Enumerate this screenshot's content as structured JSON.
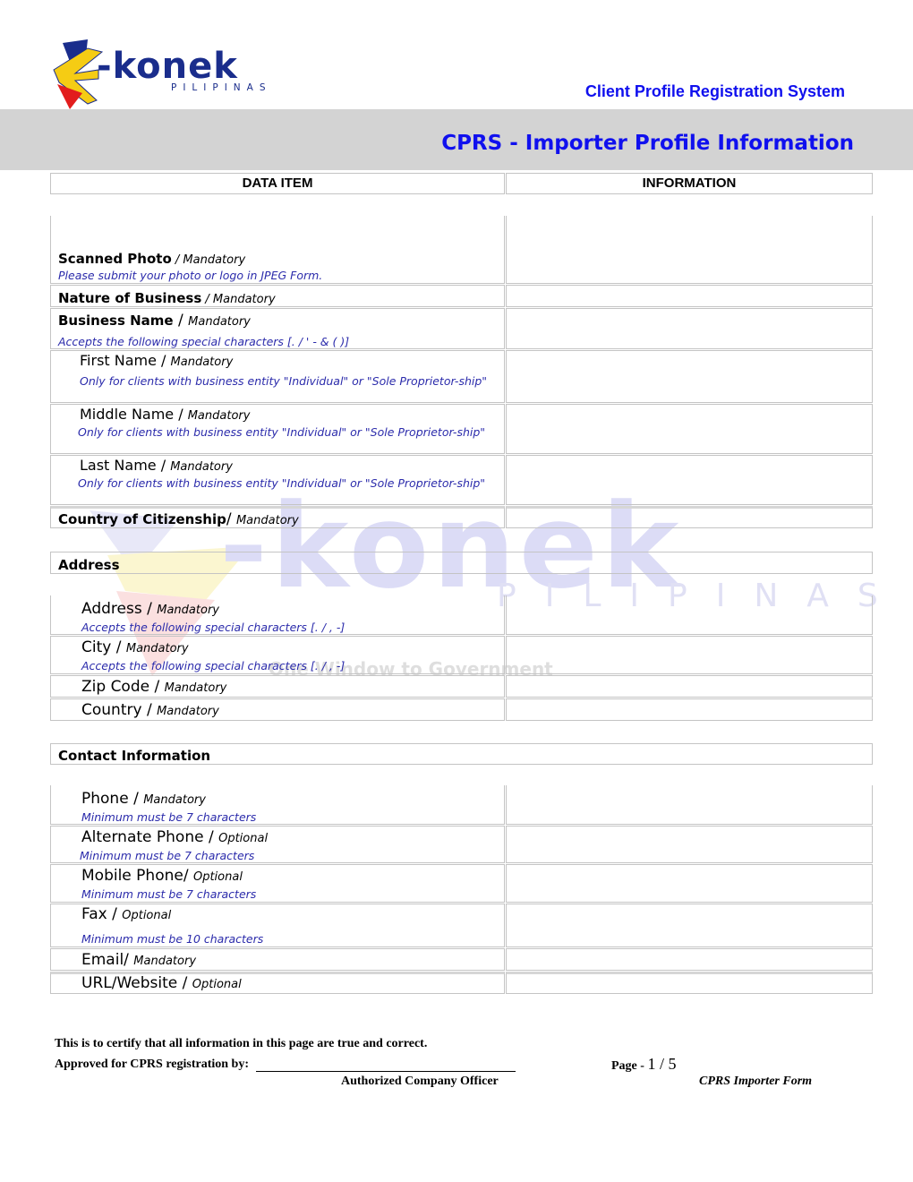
{
  "header": {
    "logo_text": "-konek",
    "logo_subtext": "PILIPINAS",
    "system_title": "Client Profile Registration System",
    "page_title": "CPRS - Importer Profile Information"
  },
  "watermark": {
    "word": "-konek",
    "sub": "PILIPINAS",
    "tagline": "One Window to Government"
  },
  "table": {
    "columns": [
      "DATA ITEM",
      "INFORMATION"
    ],
    "profile_rows": [
      {
        "label": "Scanned Photo",
        "requirement": " / Mandatory",
        "hint": "Please submit your photo or logo in JPEG Form.",
        "value": ""
      },
      {
        "label": "Nature of Business",
        "requirement": " / Mandatory",
        "hint": "",
        "value": ""
      },
      {
        "label": "Business Name",
        "separator": " / ",
        "requirement": "Mandatory",
        "hint": "Accepts the following special characters [. / ' - & ( )]",
        "value": ""
      },
      {
        "label": "First Name / ",
        "requirement": "Mandatory",
        "hint": "Only for clients with business entity \"Individual\" or \"Sole Proprietor-ship\"",
        "value": ""
      },
      {
        "label": "Middle Name / ",
        "requirement": "Mandatory",
        "hint": "Only for clients with business entity \"Individual\" or \"Sole Proprietor-ship\"",
        "value": ""
      },
      {
        "label": "Last Name / ",
        "requirement": "Mandatory",
        "hint": "Only for clients with business entity \"Individual\" or \"Sole Proprietor-ship\"",
        "value": ""
      },
      {
        "label": "Country of Citizenship",
        "separator": "/ ",
        "requirement": "Mandatory",
        "hint": "",
        "value": ""
      }
    ],
    "address_section": "Address",
    "address_rows": [
      {
        "label": "Address / ",
        "requirement": "Mandatory",
        "hint": "Accepts the following special characters [. / , -]",
        "value": ""
      },
      {
        "label": "City / ",
        "requirement": "Mandatory",
        "hint": "Accepts the following special characters [. / , -]",
        "value": ""
      },
      {
        "label": "Zip Code / ",
        "requirement": "Mandatory",
        "hint": "",
        "value": ""
      },
      {
        "label": "Country / ",
        "requirement": "Mandatory",
        "hint": "",
        "value": ""
      }
    ],
    "contact_section": "Contact Information",
    "contact_rows": [
      {
        "label": "Phone / ",
        "requirement": "Mandatory",
        "hint": "Minimum must be 7 characters",
        "value": ""
      },
      {
        "label": "Alternate Phone / ",
        "requirement": "Optional",
        "hint": "Minimum must be 7 characters",
        "value": ""
      },
      {
        "label": "Mobile Phone/ ",
        "requirement": "Optional",
        "hint": "Minimum must be 7 characters",
        "value": ""
      },
      {
        "label": "Fax / ",
        "requirement": "Optional",
        "hint": "Minimum must be 10 characters",
        "value": ""
      },
      {
        "label": "Email/ ",
        "requirement": "Mandatory",
        "hint": "",
        "value": ""
      },
      {
        "label": "URL/Website / ",
        "requirement": "Optional",
        "hint": "",
        "value": ""
      }
    ]
  },
  "footer": {
    "certify_text": "This is to certify that all information in this page are true and correct.",
    "approved_label": "Approved for CPRS registration by:",
    "signature_caption": "Authorized Company Officer",
    "page_label": "Page - ",
    "page_value": "1 / 5",
    "form_name": "CPRS Importer Form"
  },
  "colors": {
    "title_blue": "#1010ee",
    "hint_blue": "#2b2bab",
    "banner_gray": "#d3d3d3",
    "logo_navy": "#1a2d8c"
  }
}
